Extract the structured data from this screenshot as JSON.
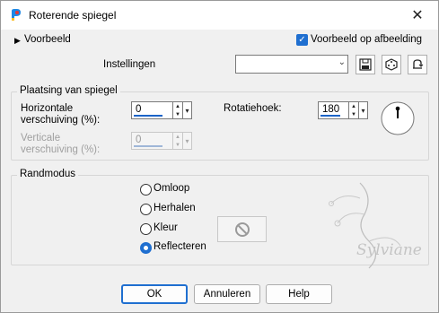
{
  "window": {
    "title": "Roterende spiegel",
    "close_glyph": "✕"
  },
  "preview": {
    "label": "Voorbeeld",
    "auto_preview_label": "Voorbeeld op afbeelding",
    "auto_preview_checked": true
  },
  "settings": {
    "label": "Instellingen",
    "value": ""
  },
  "placement": {
    "title": "Plaatsing van spiegel",
    "horizontal_label_1": "Horizontale",
    "horizontal_label_2": "verschuiving (%):",
    "horizontal_value": "0",
    "vertical_label_1": "Verticale",
    "vertical_label_2": "verschuiving (%):",
    "vertical_value": "0",
    "rotation_label": "Rotatiehoek:",
    "rotation_value": "180"
  },
  "edge_mode": {
    "title": "Randmodus",
    "options": [
      "Omloop",
      "Herhalen",
      "Kleur",
      "Reflecteren"
    ],
    "selected": "Reflecteren"
  },
  "watermark": {
    "text": "Sylviane"
  },
  "buttons": {
    "ok": "OK",
    "cancel": "Annuleren",
    "help": "Help"
  },
  "colors": {
    "accent": "#1f6fd0",
    "dialog_bg": "#f0f0f0"
  }
}
